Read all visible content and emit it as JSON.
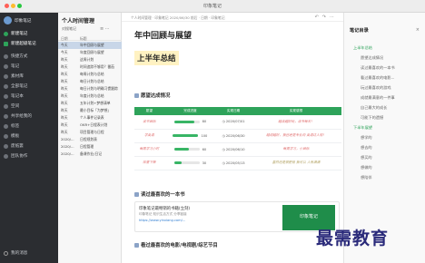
{
  "window": {
    "title": "印象笔记"
  },
  "sidebar": {
    "user": "印象笔记",
    "new_note": "新建笔记",
    "new_markdown": "新建超级笔记",
    "items": [
      {
        "label": "快捷方式",
        "icon": "star-icon"
      },
      {
        "label": "笔记",
        "icon": "note-icon"
      },
      {
        "label": "素材库",
        "icon": "image-icon"
      },
      {
        "label": "全部笔记",
        "icon": "notes-icon"
      },
      {
        "label": "笔记本",
        "icon": "notebook-icon"
      },
      {
        "label": "空间",
        "icon": "space-icon"
      },
      {
        "label": "共享给我的",
        "icon": "share-icon"
      },
      {
        "label": "标签",
        "icon": "tag-icon"
      },
      {
        "label": "模板",
        "icon": "template-icon"
      },
      {
        "label": "废纸篓",
        "icon": "trash-icon"
      },
      {
        "label": "团队协作",
        "icon": "team-icon"
      }
    ],
    "bottom": "我的消息"
  },
  "list": {
    "title": "个人时间管理",
    "search": "对搜笔记",
    "header_date": "日期",
    "header_title": "标题",
    "rows": [
      {
        "date": "今天",
        "title": "年中回顾与展望"
      },
      {
        "date": "今天",
        "title": "年度回顾与展望"
      },
      {
        "date": "昨天",
        "title": "这周计划"
      },
      {
        "date": "昨天",
        "title": "时间追踪不够用？番茄"
      },
      {
        "date": "昨天",
        "title": "每周计划与总结"
      },
      {
        "date": "昨天",
        "title": "每日计划与总结"
      },
      {
        "date": "昨天",
        "title": "每日计划与明确习惯跟踪"
      },
      {
        "date": "昨天",
        "title": "年度计划与总结"
      },
      {
        "date": "昨天",
        "title": "五年计划+梦想清单"
      },
      {
        "date": "昨天",
        "title": "最小目标「为梦想」"
      },
      {
        "date": "昨天",
        "title": "个人事件记录表"
      },
      {
        "date": "昨天",
        "title": "OKR+日程表计划"
      },
      {
        "date": "昨天",
        "title": "项目管理与日程"
      },
      {
        "date": "2020/...",
        "title": "日程规划表"
      },
      {
        "date": "2020/...",
        "title": "日程管理"
      },
      {
        "date": "2020/...",
        "title": "备课作业/日记"
      }
    ]
  },
  "editor": {
    "breadcrumb": "个人时间管理 · 印象笔记 2020/06/30 前后 · 日期 · 印象笔记",
    "doc_title": "年中回顾与展望",
    "h1": "上半年总结",
    "section1": "愿望达成情况",
    "table": {
      "headers": [
        "愿望",
        "完成进度",
        "实现日期",
        "实现感想"
      ],
      "rows": [
        {
          "wish": "读书目标",
          "progress": 80,
          "date": "2020/07/01",
          "note": "越读越好玩，读书每天！",
          "note_style": "red"
        },
        {
          "wish": "学英语",
          "progress": 100,
          "date": "2020/06/30",
          "note": "越说越好，我已经是专业的 英语达人啦！",
          "note_style": "red"
        },
        {
          "wish": "每周学习小时",
          "progress": 60,
          "date": "2020/06/10",
          "note": "每周学习，小目标",
          "note_style": "red"
        },
        {
          "wish": "体重下降",
          "progress": 30,
          "date": "2020/05/13",
          "note": "虽然还是很肥但 我可以 人有满满",
          "note_style": "gold"
        }
      ]
    },
    "section2": "读过最喜欢的一本书",
    "card": {
      "title": "印象笔记最畅销的书籍(立刻)",
      "subtitle": "印象笔记 知识生活方式 分享链接",
      "link": "https://www.yinxiang.com/...",
      "thumb_text": "印象笔记"
    },
    "section3": "看过最喜欢的电影/电视剧/综艺节目"
  },
  "outline": {
    "title": "笔记目录",
    "close": "×",
    "items": [
      {
        "level": 1,
        "label": "上半年总结"
      },
      {
        "level": 2,
        "label": "愿望达成情况"
      },
      {
        "level": 2,
        "label": "读过最喜欢的一本书"
      },
      {
        "level": 2,
        "label": "看过最喜欢的电影..."
      },
      {
        "level": 2,
        "label": "玩过最喜欢的游戏"
      },
      {
        "level": 2,
        "label": "成就最满意的一件事"
      },
      {
        "level": 2,
        "label": "自己最大的成长"
      },
      {
        "level": 2,
        "label": "可能下的遗憾"
      },
      {
        "level": 1,
        "label": "下半年展望"
      },
      {
        "level": 2,
        "label": "想学的"
      },
      {
        "level": 2,
        "label": "想去的"
      },
      {
        "level": 2,
        "label": "想买的"
      },
      {
        "level": 2,
        "label": "想做的"
      },
      {
        "level": 2,
        "label": "想陪伴"
      }
    ]
  },
  "watermark": "最需教育",
  "colors": {
    "accent": "#2ea35a",
    "sidebar_bg": "#2b2d31",
    "highlight": "#fff2c2"
  }
}
